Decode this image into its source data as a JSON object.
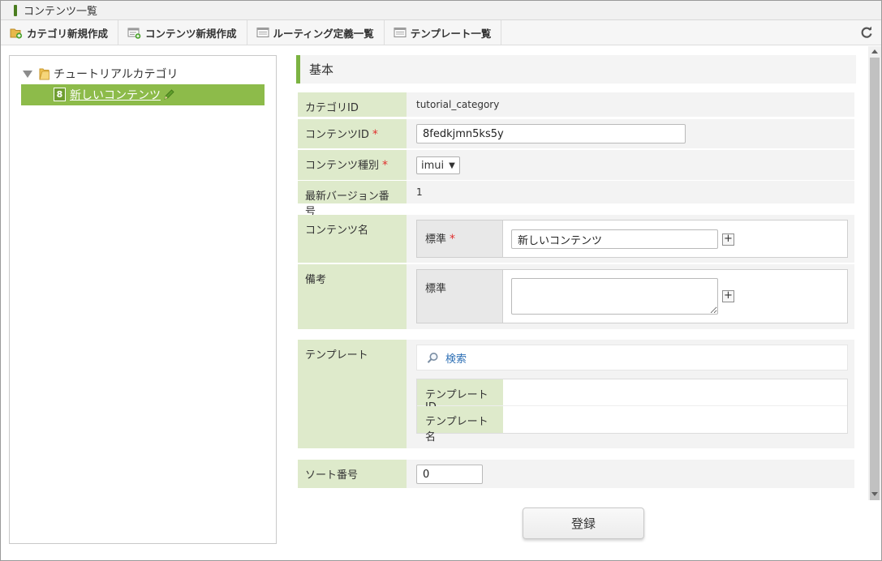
{
  "window": {
    "title": "コンテンツ一覧"
  },
  "toolbar": {
    "items": [
      {
        "label": "カテゴリ新規作成",
        "icon": "folder-add-icon"
      },
      {
        "label": "コンテンツ新規作成",
        "icon": "content-add-icon"
      },
      {
        "label": "ルーティング定義一覧",
        "icon": "list-icon"
      },
      {
        "label": "テンプレート一覧",
        "icon": "list-icon"
      }
    ],
    "refresh_icon": "refresh-icon"
  },
  "tree": {
    "category": "チュートリアルカテゴリ",
    "selected_badge": "8",
    "selected_label": "新しいコンテンツ"
  },
  "section": {
    "title": "基本"
  },
  "form": {
    "category_id": {
      "label": "カテゴリID",
      "value": "tutorial_category"
    },
    "content_id": {
      "label": "コンテンツID",
      "required": "*",
      "value": "8fedkjmn5ks5y"
    },
    "content_type": {
      "label": "コンテンツ種別",
      "required": "*",
      "value": "imui"
    },
    "latest_version": {
      "label": "最新バージョン番号",
      "value": "1"
    },
    "content_name": {
      "label": "コンテンツ名",
      "sublabel": "標準",
      "required": "*",
      "value": "新しいコンテンツ",
      "add": "+"
    },
    "remarks": {
      "label": "備考",
      "sublabel": "標準",
      "value": "",
      "add": "+"
    },
    "template": {
      "label": "テンプレート",
      "search_label": "検索",
      "id_label": "テンプレートID",
      "id_value": "",
      "name_label": "テンプレート名",
      "name_value": ""
    },
    "sort_number": {
      "label": "ソート番号",
      "value": "0"
    }
  },
  "submit_label": "登録",
  "colors": {
    "accent_green": "#8dbb4a",
    "label_bg": "#deeacb",
    "required_red": "#e0302f",
    "link_blue": "#2d6fb5"
  }
}
